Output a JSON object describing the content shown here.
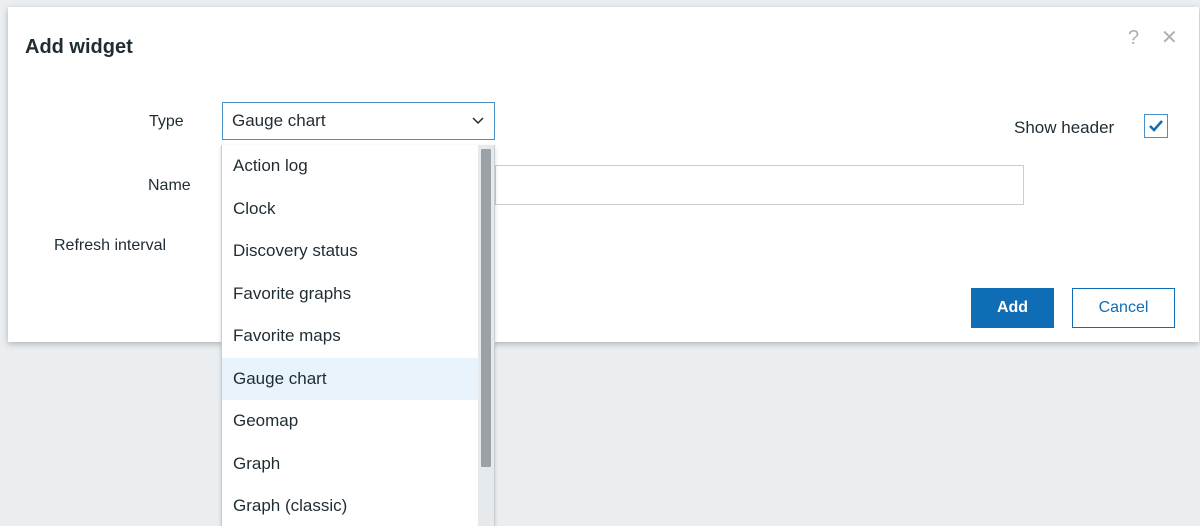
{
  "dialog": {
    "title": "Add widget",
    "help_glyph": "?",
    "close_glyph": "✕"
  },
  "form": {
    "type_label": "Type",
    "type_selected": "Gauge chart",
    "name_label": "Name",
    "name_value": "",
    "refresh_label": "Refresh interval",
    "show_header_label": "Show header",
    "show_header_checked": true
  },
  "dropdown": {
    "options": [
      "Action log",
      "Clock",
      "Discovery status",
      "Favorite graphs",
      "Favorite maps",
      "Gauge chart",
      "Geomap",
      "Graph",
      "Graph (classic)"
    ],
    "selected_index": 5
  },
  "buttons": {
    "add_label": "Add",
    "cancel_label": "Cancel"
  },
  "colors": {
    "accent": "#0f6db5",
    "highlight": "#e8f3fb",
    "backdrop": "#ebeef0"
  }
}
